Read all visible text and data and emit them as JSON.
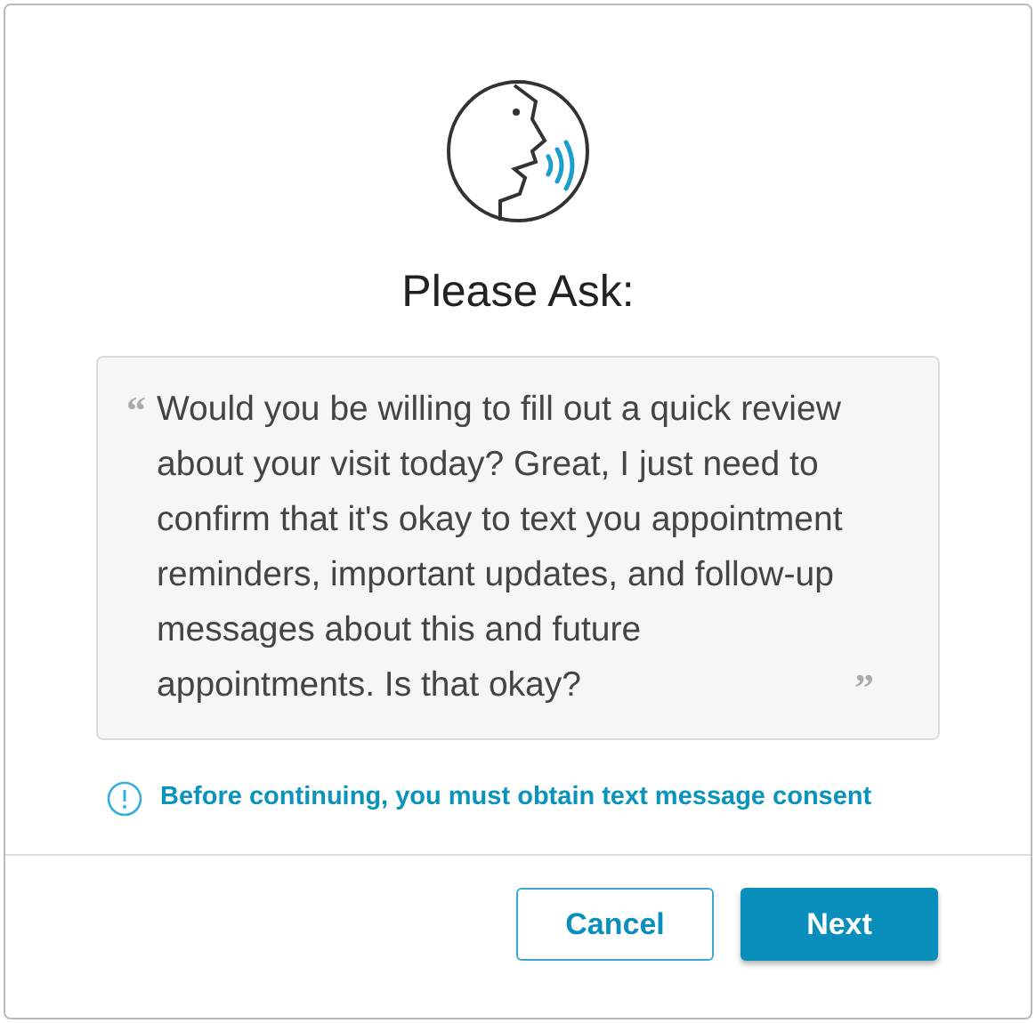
{
  "dialog": {
    "title": "Please Ask:",
    "script": {
      "open_mark": "“",
      "text": "Would you be willing to fill out a quick review about your visit today? Great, I just need to confirm that it's okay to text you appointment reminders, important updates, and follow-up messages about this and future appointments. Is that okay?",
      "close_mark": "”"
    },
    "notice": "Before continuing, you must obtain text message consent",
    "buttons": [
      {
        "label": "Cancel",
        "kind": "secondary"
      },
      {
        "label": "Next",
        "kind": "primary"
      }
    ]
  }
}
